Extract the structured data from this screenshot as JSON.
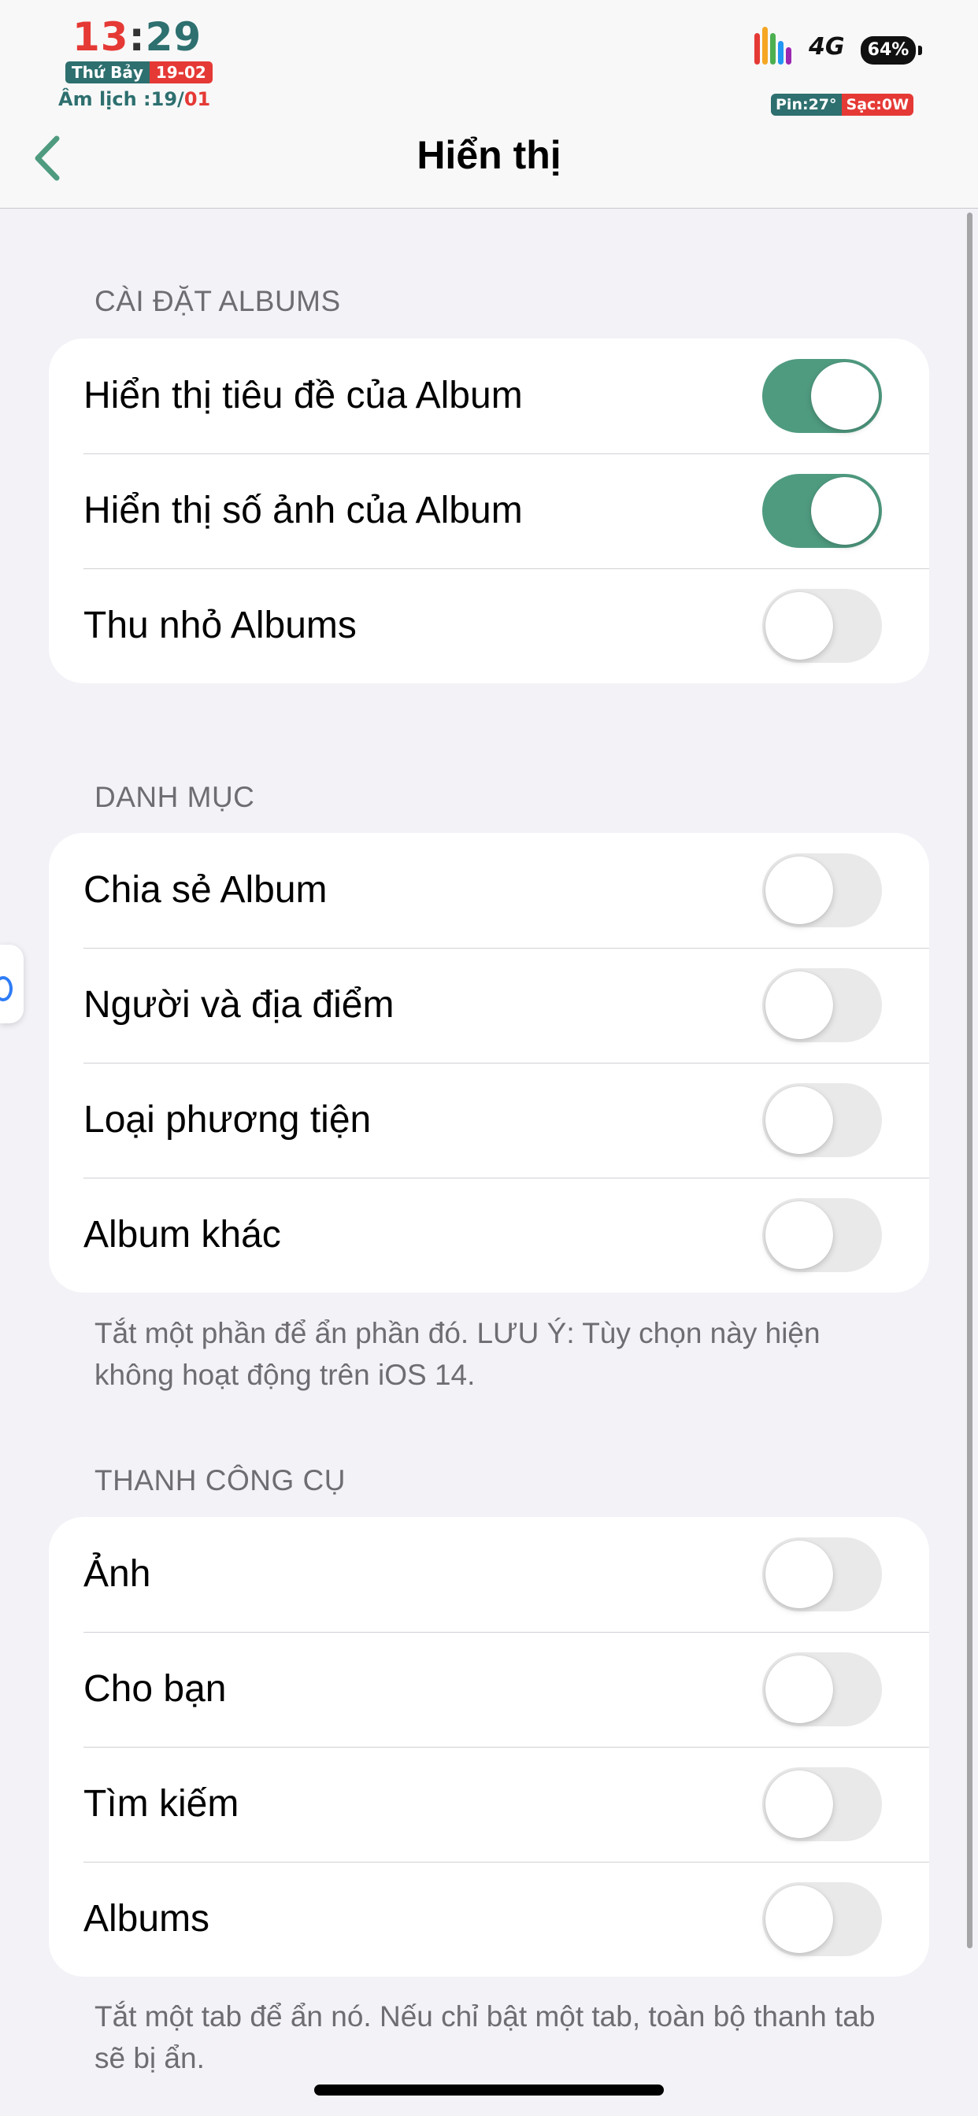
{
  "status_bar": {
    "time_hour": "13",
    "time_sep": ":",
    "time_min": "29",
    "weekday": "Thứ Bảy",
    "date": "19-02",
    "lunar_label": "Âm lịch :19/",
    "lunar_month": "01",
    "network": "4G",
    "battery": "64%",
    "pin": "Pin:27°",
    "sac": "Sạc:0W",
    "signal_colors": [
      "#e53935",
      "#f5a623",
      "#4caf50",
      "#2196f3",
      "#9c27b0"
    ]
  },
  "nav": {
    "title": "Hiển thị",
    "back_icon": "chevron-left-icon",
    "accent": "#4f9b80"
  },
  "sections": [
    {
      "header": "CÀI ĐẶT ALBUMS",
      "rows": [
        {
          "label": "Hiển thị tiêu đề của Album",
          "on": true
        },
        {
          "label": "Hiển thị số ảnh của Album",
          "on": true
        },
        {
          "label": "Thu nhỏ Albums",
          "on": false
        }
      ],
      "footer": ""
    },
    {
      "header": "DANH MỤC",
      "rows": [
        {
          "label": "Chia sẻ Album",
          "on": false
        },
        {
          "label": "Người và địa điểm",
          "on": false
        },
        {
          "label": "Loại phương tiện",
          "on": false
        },
        {
          "label": "Album khác",
          "on": false
        }
      ],
      "footer": "Tắt một phần để ẩn phần đó. LƯU Ý: Tùy chọn này hiện không hoạt động trên iOS 14."
    },
    {
      "header": "THANH CÔNG CỤ",
      "rows": [
        {
          "label": "Ảnh",
          "on": false
        },
        {
          "label": "Cho bạn",
          "on": false
        },
        {
          "label": "Tìm kiếm",
          "on": false
        },
        {
          "label": "Albums",
          "on": false
        }
      ],
      "footer": "Tắt một tab để ẩn nó. Nếu chỉ bật một tab, toàn bộ thanh tab sẽ bị ẩn."
    }
  ]
}
